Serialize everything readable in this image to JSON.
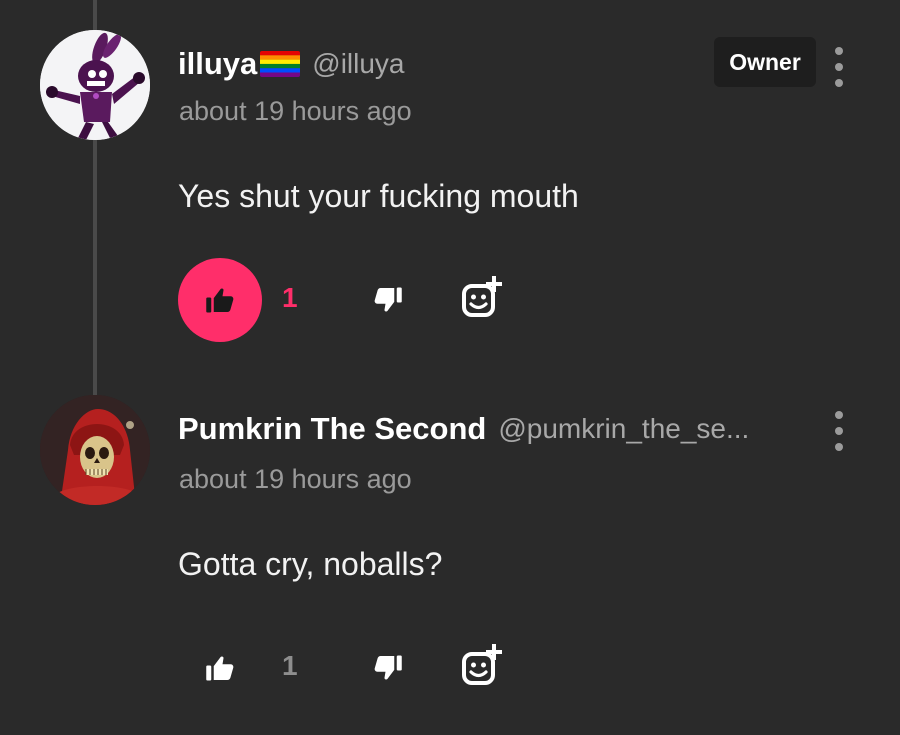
{
  "colors": {
    "background": "#2a2a2a",
    "accent": "#ff2e6a",
    "muted_text": "#9a9a9a",
    "badge_bg": "#1e1e1e"
  },
  "comments": [
    {
      "author": "illuya",
      "handle": "@illuya",
      "flag_icon": "rainbow-flag-icon",
      "badge": "Owner",
      "timestamp": "about 19 hours ago",
      "text": "Yes shut your fucking mouth",
      "likes": "1",
      "liked": true
    },
    {
      "author": "Pumkrin The Second",
      "handle": "@pumkrin_the_se...",
      "timestamp": "about 19 hours ago",
      "text": "Gotta cry, noballs?",
      "likes": "1",
      "liked": false
    }
  ],
  "icons": {
    "like": "thumbs-up-icon",
    "dislike": "thumbs-down-icon",
    "react": "add-emoji-icon",
    "more": "more-vertical-icon"
  }
}
